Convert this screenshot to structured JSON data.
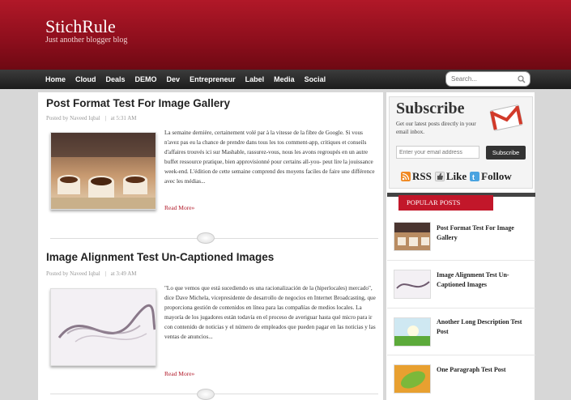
{
  "header": {
    "site_title": "StichRule",
    "tagline": "Just another blogger blog"
  },
  "nav": {
    "items": [
      "Home",
      "Cloud",
      "Deals",
      "DEMO",
      "Dev",
      "Entrepreneur",
      "Label",
      "Media",
      "Social"
    ]
  },
  "search": {
    "placeholder": "Search..."
  },
  "posts": [
    {
      "title": "Post Format Test For Image Gallery",
      "meta_author": "Posted by Naveed Iqbal",
      "meta_time": "at  5:31 AM",
      "excerpt": "La semaine dernière, certainement volé par à la vitesse de la fibre de Google. Si vous n'avez pas eu la chance de prendre dans tous les tos comment-app, critiques et conseils d'affaires trouvés ici sur Mashable, rassurez-vous, nous les avons regroupés en un autre buffet ressource pratique, bien approvisionné pour certains all-you- peut lire la jouissance week-end. L'édition de cette semaine comprend des moyens faciles de faire une différence avec les médias...",
      "read_more": "Read More»"
    },
    {
      "title": "Image Alignment Test Un-Captioned Images",
      "meta_author": "Posted by Naveed Iqbal",
      "meta_time": "at  3:49 AM",
      "excerpt": "\"Lo que vemos que está sucediendo es una racionalización de la (hiperlocales) mercado\", dice Dave Michela, vicepresidente de desarrollo de negocios en Internet Broadcasting, que proporciona gestión de contenidos en línea para las compañías de medios locales. La mayoría de los jugadores están todavía en el proceso de averiguar hasta qué micro para ir con contenido de noticias y el número de empleados que pueden pagar en las noticias y las ventas de anuncios...",
      "read_more": "Read More»"
    }
  ],
  "sidebar": {
    "subscribe_heading": "Subscribe",
    "subscribe_text": "Get our latest posts directly in your email inbox.",
    "email_placeholder": "Enter your email address",
    "subscribe_button": "Subscribe",
    "feeds": {
      "rss": "RSS",
      "like": "Like",
      "follow": "Follow"
    },
    "popular_heading": "POPULAR POSTS",
    "popular_posts": [
      "Post Format Test For Image Gallery",
      "Image Alignment Test Un-Captioned Images",
      "Another Long Description Test Post",
      "One Paragraph Test Post"
    ]
  },
  "colors": {
    "brand_red": "#b11828",
    "nav_dark": "#2a2a2a"
  },
  "icons": [
    "search-icon",
    "gmail-icon",
    "rss-icon",
    "like-icon",
    "twitter-icon"
  ]
}
